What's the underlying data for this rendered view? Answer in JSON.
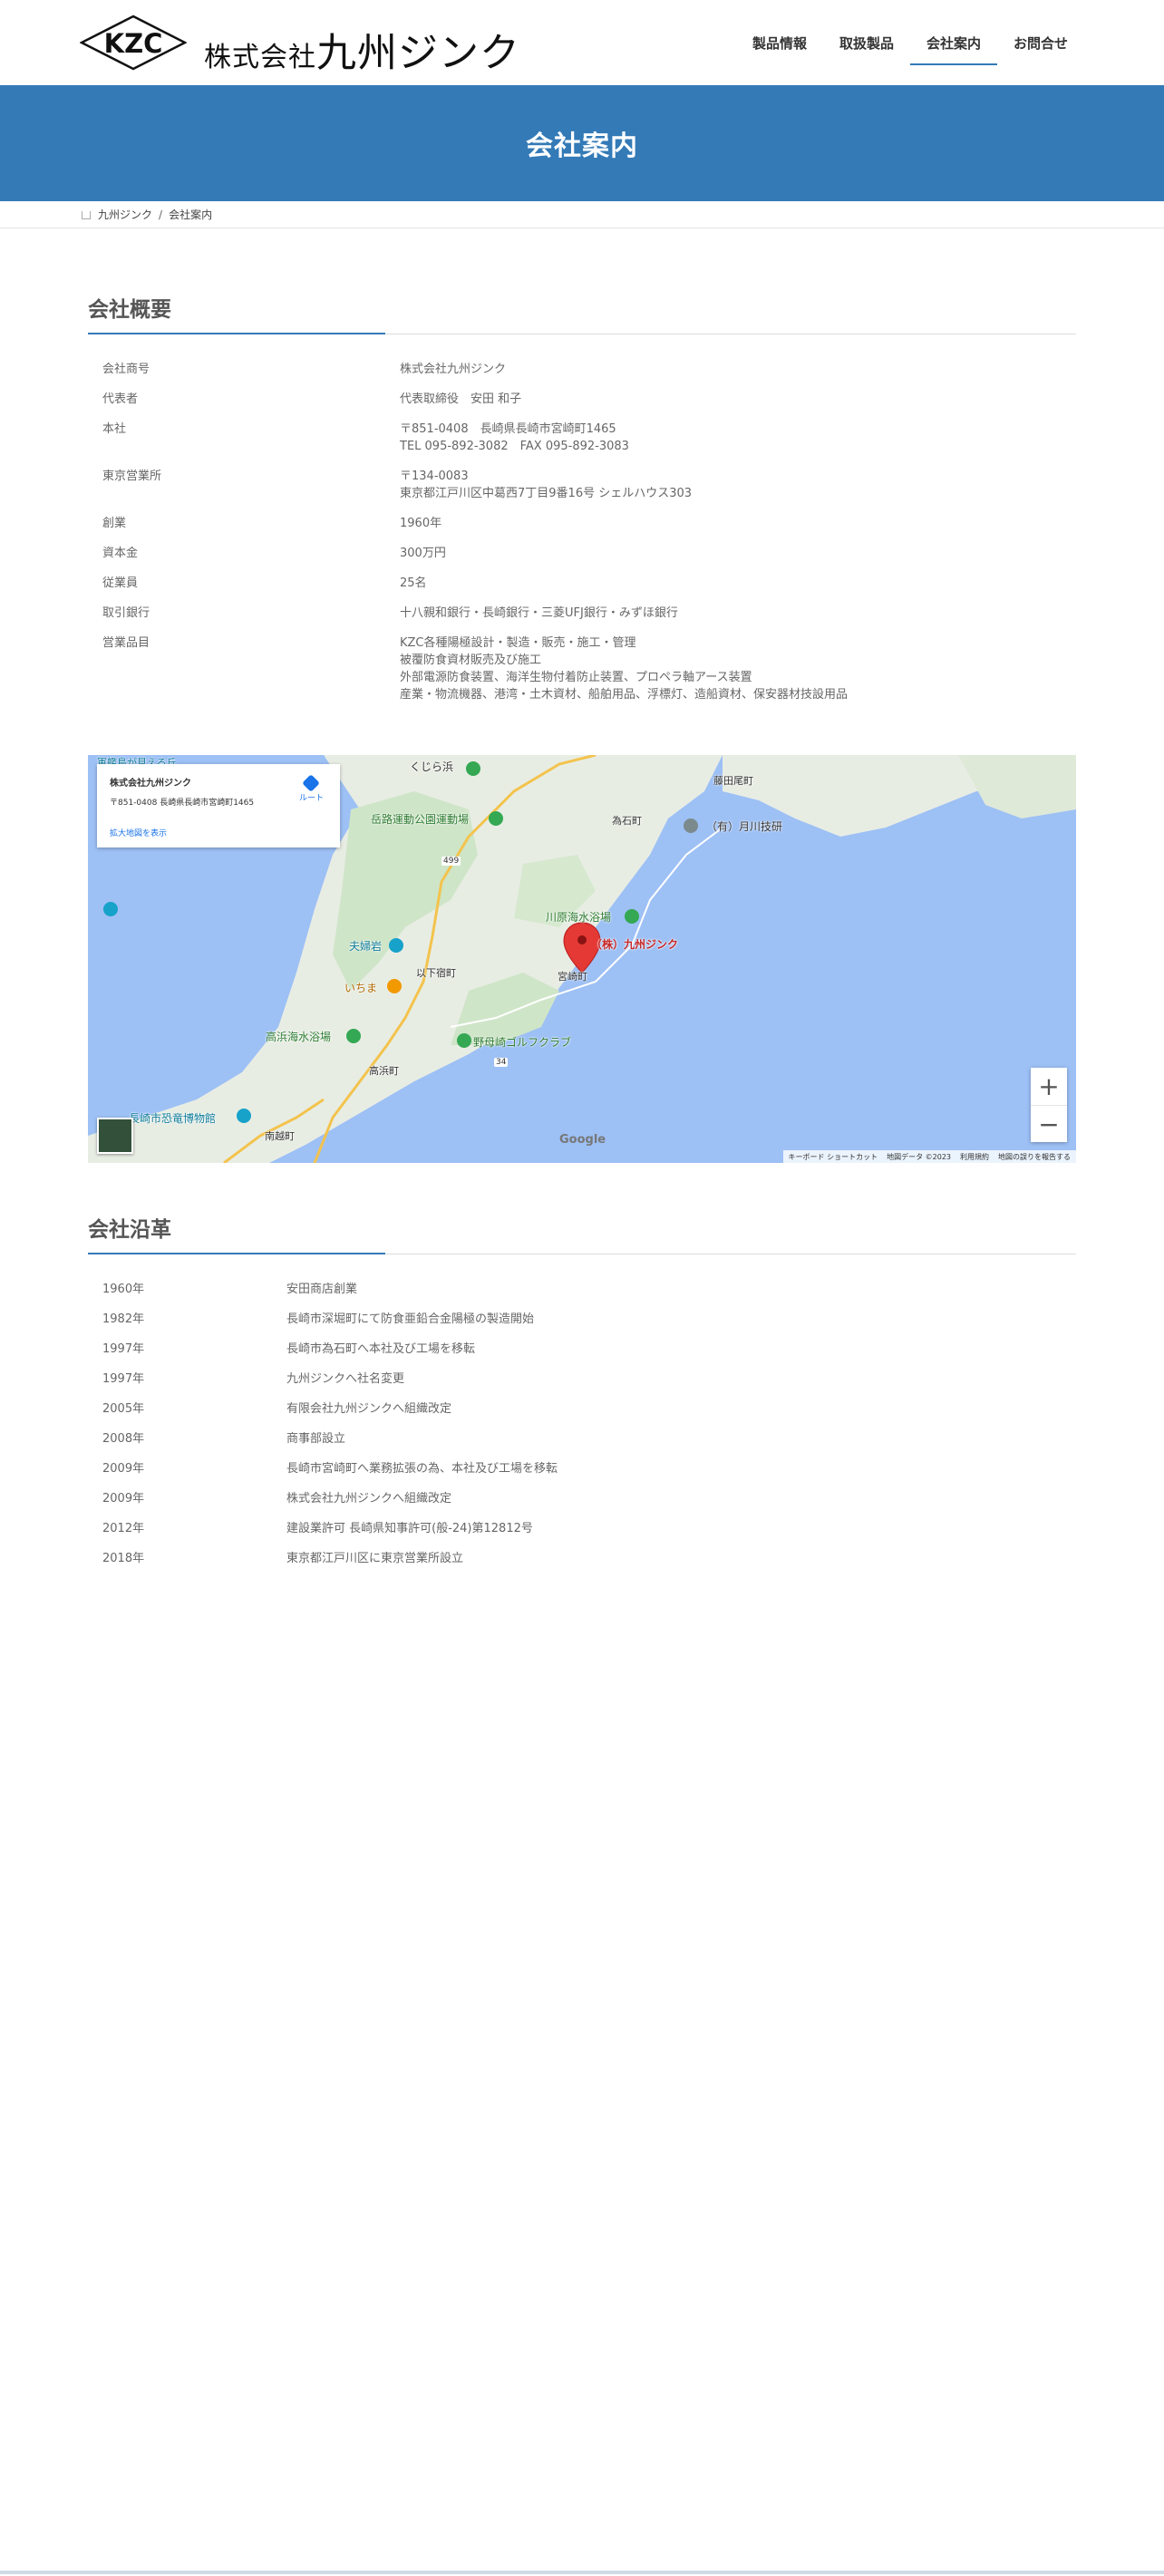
{
  "header": {
    "logo_mark": "KZC",
    "logo_prefix": "株式会社",
    "logo_name": "九州ジンク",
    "nav": [
      {
        "label": "製品情報"
      },
      {
        "label": "取扱製品"
      },
      {
        "label": "会社案内",
        "active": true
      },
      {
        "label": "お問合せ"
      }
    ]
  },
  "page_title": "会社案内",
  "breadcrumb": {
    "home": "九州ジンク",
    "separator": "/",
    "current": "会社案内"
  },
  "overview": {
    "title": "会社概要",
    "rows": [
      {
        "key": "会社商号",
        "lines": [
          "株式会社九州ジンク"
        ]
      },
      {
        "key": "代表者",
        "lines": [
          "代表取締役　安田 和子"
        ]
      },
      {
        "key": "本社",
        "lines": [
          "〒851-0408　長崎県長崎市宮崎町1465",
          "TEL 095-892-3082　FAX 095-892-3083"
        ]
      },
      {
        "key": "東京営業所",
        "lines": [
          "〒134-0083",
          "東京都江戸川区中葛西7丁目9番16号 シェルハウス303"
        ]
      },
      {
        "key": "創業",
        "lines": [
          "1960年"
        ]
      },
      {
        "key": "資本金",
        "lines": [
          "300万円"
        ]
      },
      {
        "key": "従業員",
        "lines": [
          "25名"
        ]
      },
      {
        "key": "取引銀行",
        "lines": [
          "十八親和銀行・長崎銀行・三菱UFJ銀行・みずほ銀行"
        ]
      },
      {
        "key": "営業品目",
        "lines": [
          "KZC各種陽極設計・製造・販売・施工・管理",
          "被覆防食資材販売及び施工",
          "外部電源防食装置、海洋生物付着防止装置、プロペラ軸アース装置",
          "産業・物流機器、港湾・土木資材、船舶用品、浮標灯、造船資材、保安器材技設用品"
        ]
      }
    ]
  },
  "map": {
    "card_title": "株式会社九州ジンク",
    "card_address": "〒851-0408 長崎県長崎市宮崎町1465",
    "card_route": "ルート",
    "card_link": "拡大地図を表示",
    "zoom_in": "+",
    "zoom_out": "−",
    "google": "Google",
    "footer": [
      "キーボード ショートカット",
      "地図データ ©2023",
      "利用規約",
      "地図の誤りを報告する"
    ],
    "labels": {
      "company": "（株）九州ジンク",
      "kujira": "くじら浜",
      "fuji": "藤田尾町",
      "tameishi": "為石町",
      "tsukigawa": "（有）月川技研",
      "park": "岳路運動公園運動場",
      "kawahara": "川原海水浴場",
      "miyazaki": "宮崎町",
      "meotoiwa": "夫婦岩",
      "iremai": "いちま",
      "ishita": "以下宿町",
      "takahama_beach": "高浜海水浴場",
      "golf": "野母崎ゴルフクラブ",
      "takahama": "高浜町",
      "museum": "長崎市恐竜博物館",
      "minamikoshi": "南越町",
      "kanbana": "軍艦島が見える丘",
      "route499": "499",
      "route34": "34"
    }
  },
  "history": {
    "title": "会社沿革",
    "rows": [
      {
        "year": "1960年",
        "event": "安田商店創業"
      },
      {
        "year": "1982年",
        "event": "長崎市深堀町にて防食亜鉛合金陽極の製造開始"
      },
      {
        "year": "1997年",
        "event": "長崎市為石町へ本社及び工場を移転"
      },
      {
        "year": "1997年",
        "event": "九州ジンクへ社名変更"
      },
      {
        "year": "2005年",
        "event": "有限会社九州ジンクへ組織改定"
      },
      {
        "year": "2008年",
        "event": "商事部設立"
      },
      {
        "year": "2009年",
        "event": "長崎市宮崎町へ業務拡張の為、本社及び工場を移転"
      },
      {
        "year": "2009年",
        "event": "株式会社九州ジンクへ組織改定"
      },
      {
        "year": "2012年",
        "event": "建設業許可 長崎県知事許可(般-24)第12812号"
      },
      {
        "year": "2018年",
        "event": "東京都江戸川区に東京営業所設立"
      }
    ]
  },
  "colors": {
    "primary": "#337ab7",
    "text": "#666666",
    "water": "#9dc0f5",
    "land": "#e8ede4",
    "pin": "#e53935"
  }
}
